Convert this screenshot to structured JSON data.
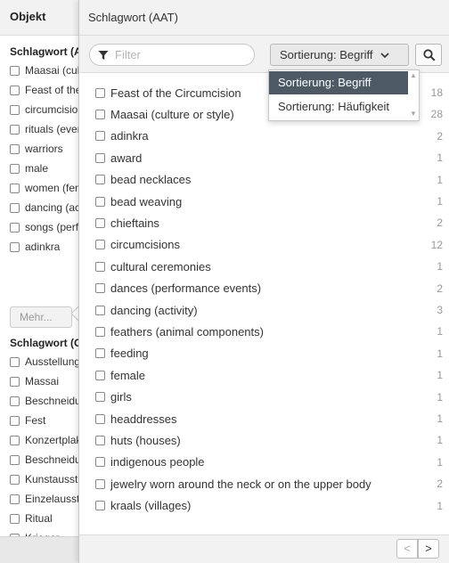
{
  "sidebar": {
    "header": "Objekt",
    "group1_title": "Schlagwort (AAT)",
    "group1_items": [
      "Maasai (culture or style)",
      "Feast of the Circumcision",
      "circumcisions",
      "rituals (events)",
      "warriors",
      "male",
      "women (female humans)",
      "dancing (activity)",
      "songs (performed music)",
      "adinkra"
    ],
    "more_label": "Mehr...",
    "group2_title": "Schlagwort (GND)",
    "group2_items": [
      "Ausstellung",
      "Massai",
      "Beschneidung",
      "Fest",
      "Konzertplakat",
      "Beschneidungsfest",
      "Kunstausstellung",
      "Einzelausstellung",
      "Ritual",
      "Krieger"
    ]
  },
  "popup": {
    "title": "Schlagwort (AAT)",
    "filter_placeholder": "Filter",
    "sort_label": "Sortierung: Begriff",
    "sort_options": [
      "Sortierung: Begriff",
      "Sortierung: Häufigkeit"
    ],
    "sort_selected": "Sortierung: Begriff",
    "facets": [
      {
        "label": "Feast of the Circumcision",
        "count": "18"
      },
      {
        "label": "Maasai (culture or style)",
        "count": "28"
      },
      {
        "label": "adinkra",
        "count": "2"
      },
      {
        "label": "award",
        "count": "1"
      },
      {
        "label": "bead necklaces",
        "count": "1"
      },
      {
        "label": "bead weaving",
        "count": "1"
      },
      {
        "label": "chieftains",
        "count": "2"
      },
      {
        "label": "circumcisions",
        "count": "12"
      },
      {
        "label": "cultural ceremonies",
        "count": "1"
      },
      {
        "label": "dances (performance events)",
        "count": "2"
      },
      {
        "label": "dancing (activity)",
        "count": "3"
      },
      {
        "label": "feathers (animal components)",
        "count": "1"
      },
      {
        "label": "feeding",
        "count": "1"
      },
      {
        "label": "female",
        "count": "1"
      },
      {
        "label": "girls",
        "count": "1"
      },
      {
        "label": "headdresses",
        "count": "1"
      },
      {
        "label": "huts (houses)",
        "count": "1"
      },
      {
        "label": "indigenous people",
        "count": "1"
      },
      {
        "label": "jewelry worn around the neck or on the upper body",
        "count": "2"
      },
      {
        "label": "kraals (villages)",
        "count": "1"
      }
    ],
    "pager_prev": "<",
    "pager_next": ">"
  },
  "colors": {
    "selected_bg": "#4d5a66",
    "count_text": "#999999",
    "panel_bg": "#f2f2f2"
  }
}
